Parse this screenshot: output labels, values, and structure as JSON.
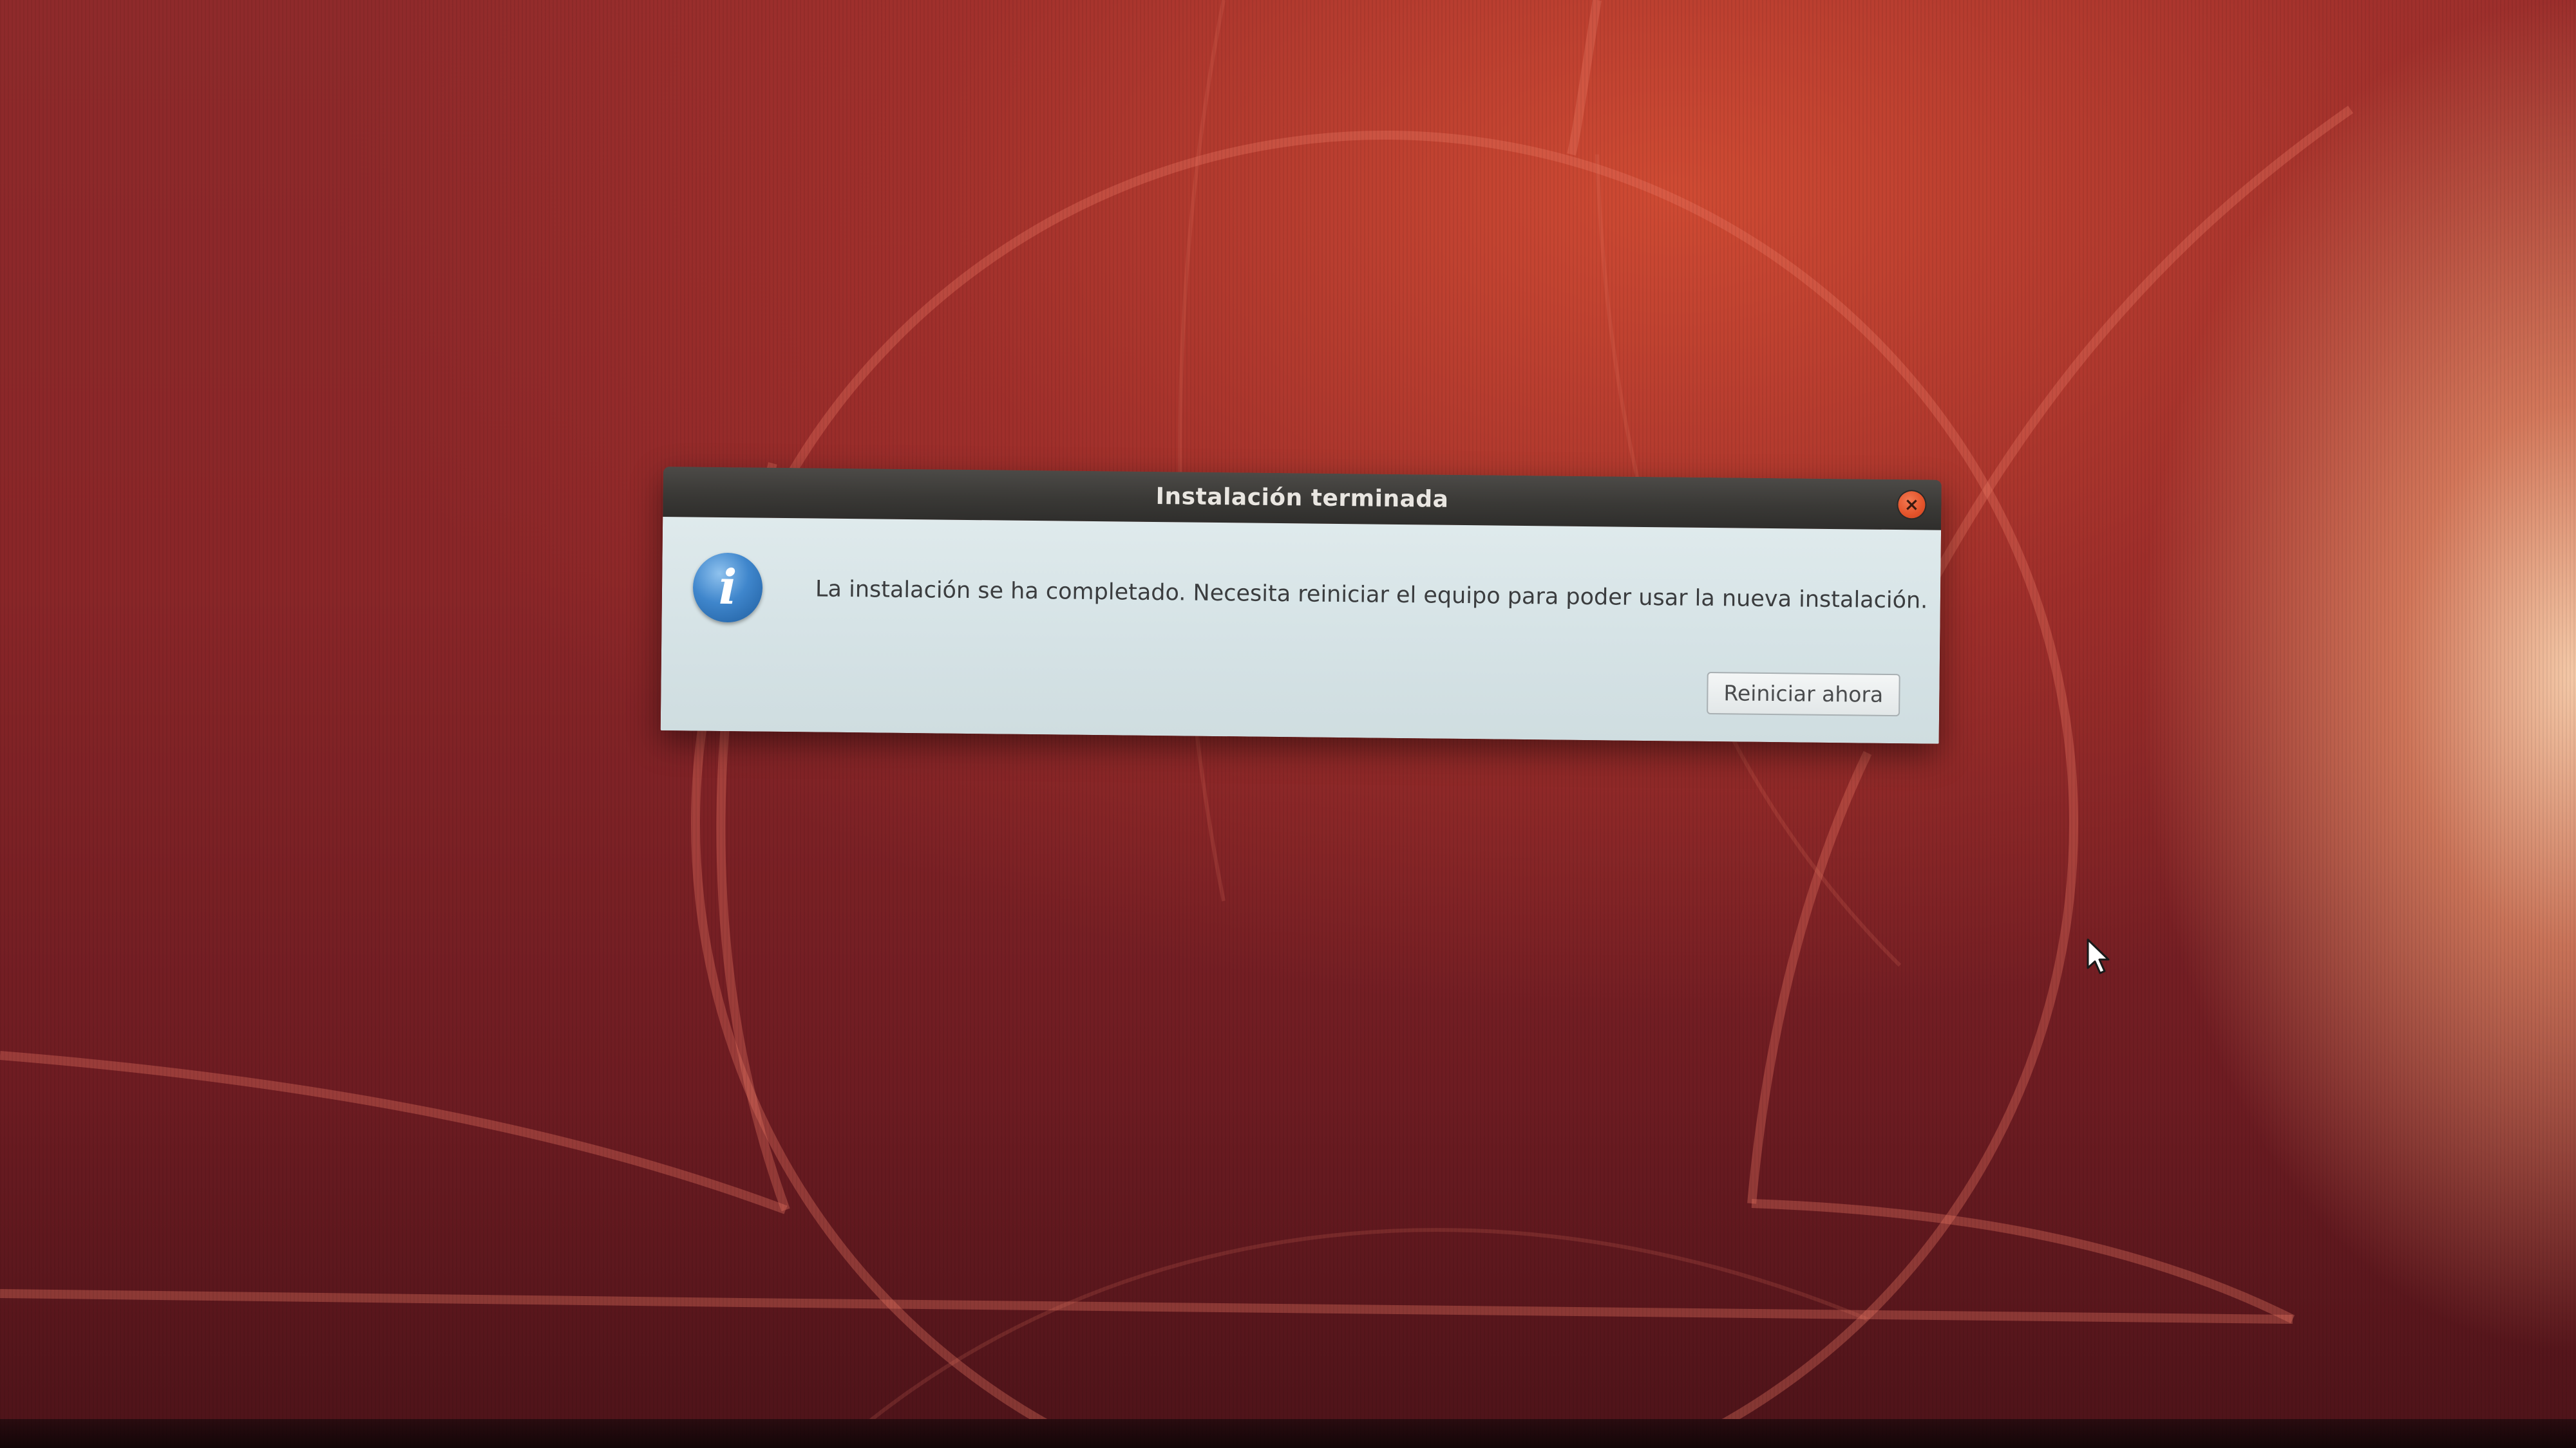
{
  "desktop": {
    "wallpaper_colors": {
      "base": "#8a2628",
      "highlight": "#d64e34",
      "glow": "#fad2af"
    }
  },
  "dialog": {
    "title": "Instalación terminada",
    "message": "La instalación se ha completado. Necesita reiniciar el equipo para poder usar la nueva instalación.",
    "close_icon": "close-icon",
    "info_icon": "info-icon",
    "info_glyph": "i",
    "close_glyph": "×",
    "button_label": "Reiniciar ahora",
    "colors": {
      "titlebar": "#3a3936",
      "body": "#d6e3e6",
      "close": "#e3532a",
      "info": "#3f86cc"
    }
  },
  "cursor": {
    "icon": "mouse-pointer-icon"
  }
}
